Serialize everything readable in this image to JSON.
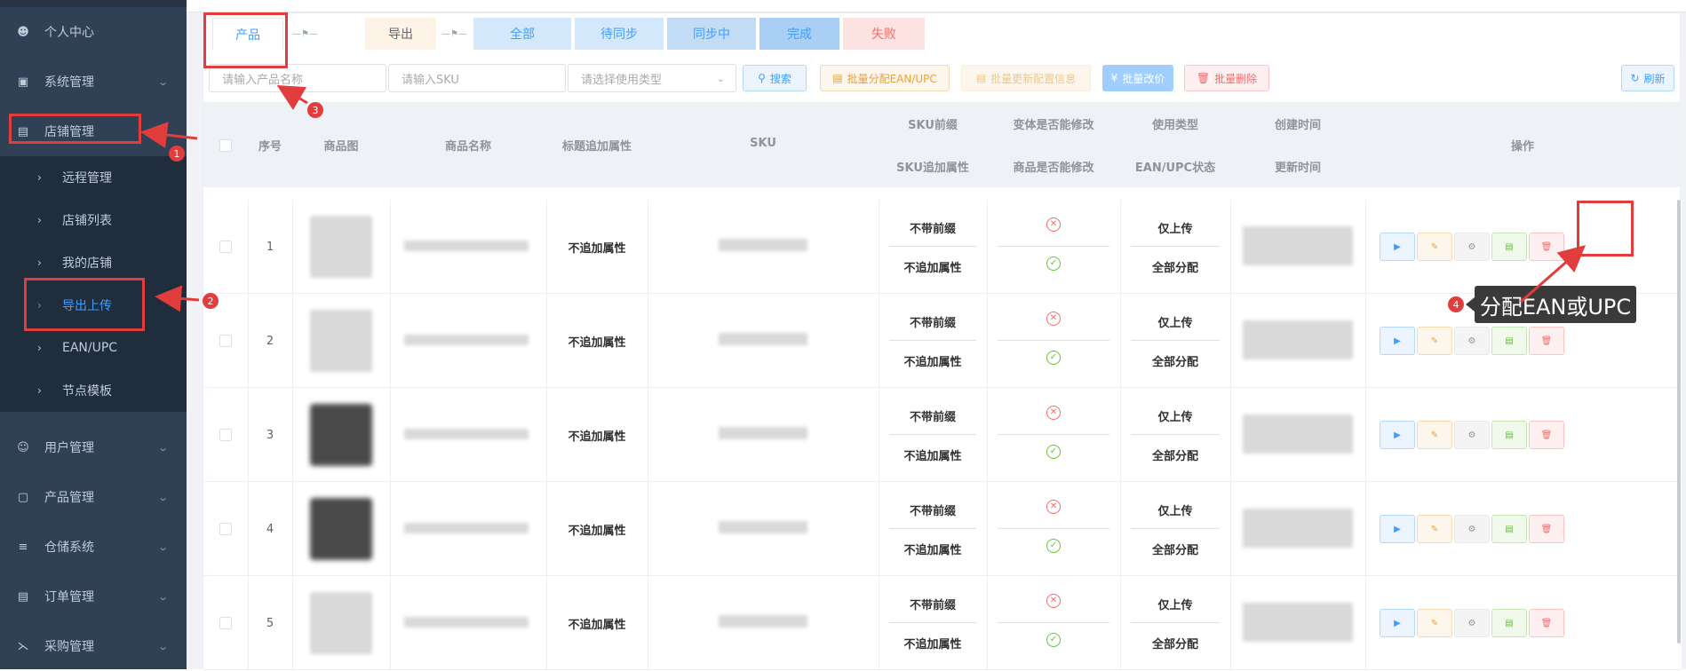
{
  "sidebar": {
    "items": [
      {
        "label": "个人中心",
        "icon": "user-icon"
      },
      {
        "label": "系统管理",
        "icon": "monitor-icon"
      },
      {
        "label": "店铺管理",
        "icon": "store-icon"
      },
      {
        "label": "用户管理",
        "icon": "users-icon"
      },
      {
        "label": "产品管理",
        "icon": "bag-icon"
      },
      {
        "label": "仓储系统",
        "icon": "warehouse-icon"
      },
      {
        "label": "订单管理",
        "icon": "order-icon"
      },
      {
        "label": "采购管理",
        "icon": "cart-icon"
      }
    ],
    "sub_items": [
      {
        "label": "远程管理"
      },
      {
        "label": "店铺列表"
      },
      {
        "label": "我的店铺"
      },
      {
        "label": "导出上传"
      },
      {
        "label": "EAN/UPC"
      },
      {
        "label": "节点模板"
      }
    ]
  },
  "tabs": {
    "product": "产品",
    "export": "导出",
    "all": "全部",
    "waiting": "待同步",
    "syncing": "同步中",
    "done": "完成",
    "failed": "失败"
  },
  "filters": {
    "name_placeholder": "请输入产品名称",
    "sku_placeholder": "请输入SKU",
    "type_placeholder": "请选择使用类型"
  },
  "toolbar": {
    "search": "搜索",
    "batch_ean": "批量分配EAN/UPC",
    "batch_cfg": "批量更新配置信息",
    "batch_price": "批量改价",
    "batch_delete": "批量删除",
    "refresh": "刷新"
  },
  "table": {
    "headers": {
      "index": "序号",
      "image": "商品图",
      "name": "商品名称",
      "title_attr": "标题追加属性",
      "sku": "SKU",
      "sku_prefix": "SKU前缀",
      "sku_suffix": "SKU追加属性",
      "variant_editable": "变体是否能修改",
      "product_editable": "商品是否能修改",
      "use_type": "使用类型",
      "ean_status": "EAN/UPC状态",
      "created": "创建时间",
      "updated": "更新时间",
      "ops": "操作"
    },
    "rows": [
      {
        "index": "1",
        "title_attr": "不追加属性",
        "sku_prefix": "不带前缀",
        "sku_suffix": "不追加属性",
        "use_type": "仅上传",
        "ean_status": "全部分配"
      },
      {
        "index": "2",
        "title_attr": "不追加属性",
        "sku_prefix": "不带前缀",
        "sku_suffix": "不追加属性",
        "use_type": "仅上传",
        "ean_status": "全部分配"
      },
      {
        "index": "3",
        "title_attr": "不追加属性",
        "sku_prefix": "不带前缀",
        "sku_suffix": "不追加属性",
        "use_type": "仅上传",
        "ean_status": "全部分配"
      },
      {
        "index": "4",
        "title_attr": "不追加属性",
        "sku_prefix": "不带前缀",
        "sku_suffix": "不追加属性",
        "use_type": "仅上传",
        "ean_status": "全部分配"
      },
      {
        "index": "5",
        "title_attr": "不追加属性",
        "sku_prefix": "不带前缀",
        "sku_suffix": "不追加属性",
        "use_type": "仅上传",
        "ean_status": "全部分配"
      }
    ]
  },
  "annotations": {
    "badge1": "1",
    "badge2": "2",
    "badge3": "3",
    "badge4": "4",
    "callout": "分配EAN或UPC"
  },
  "colors": {
    "sidebar_bg": "#304156",
    "accent": "#409eff",
    "annotation_red": "#e23d3d"
  }
}
